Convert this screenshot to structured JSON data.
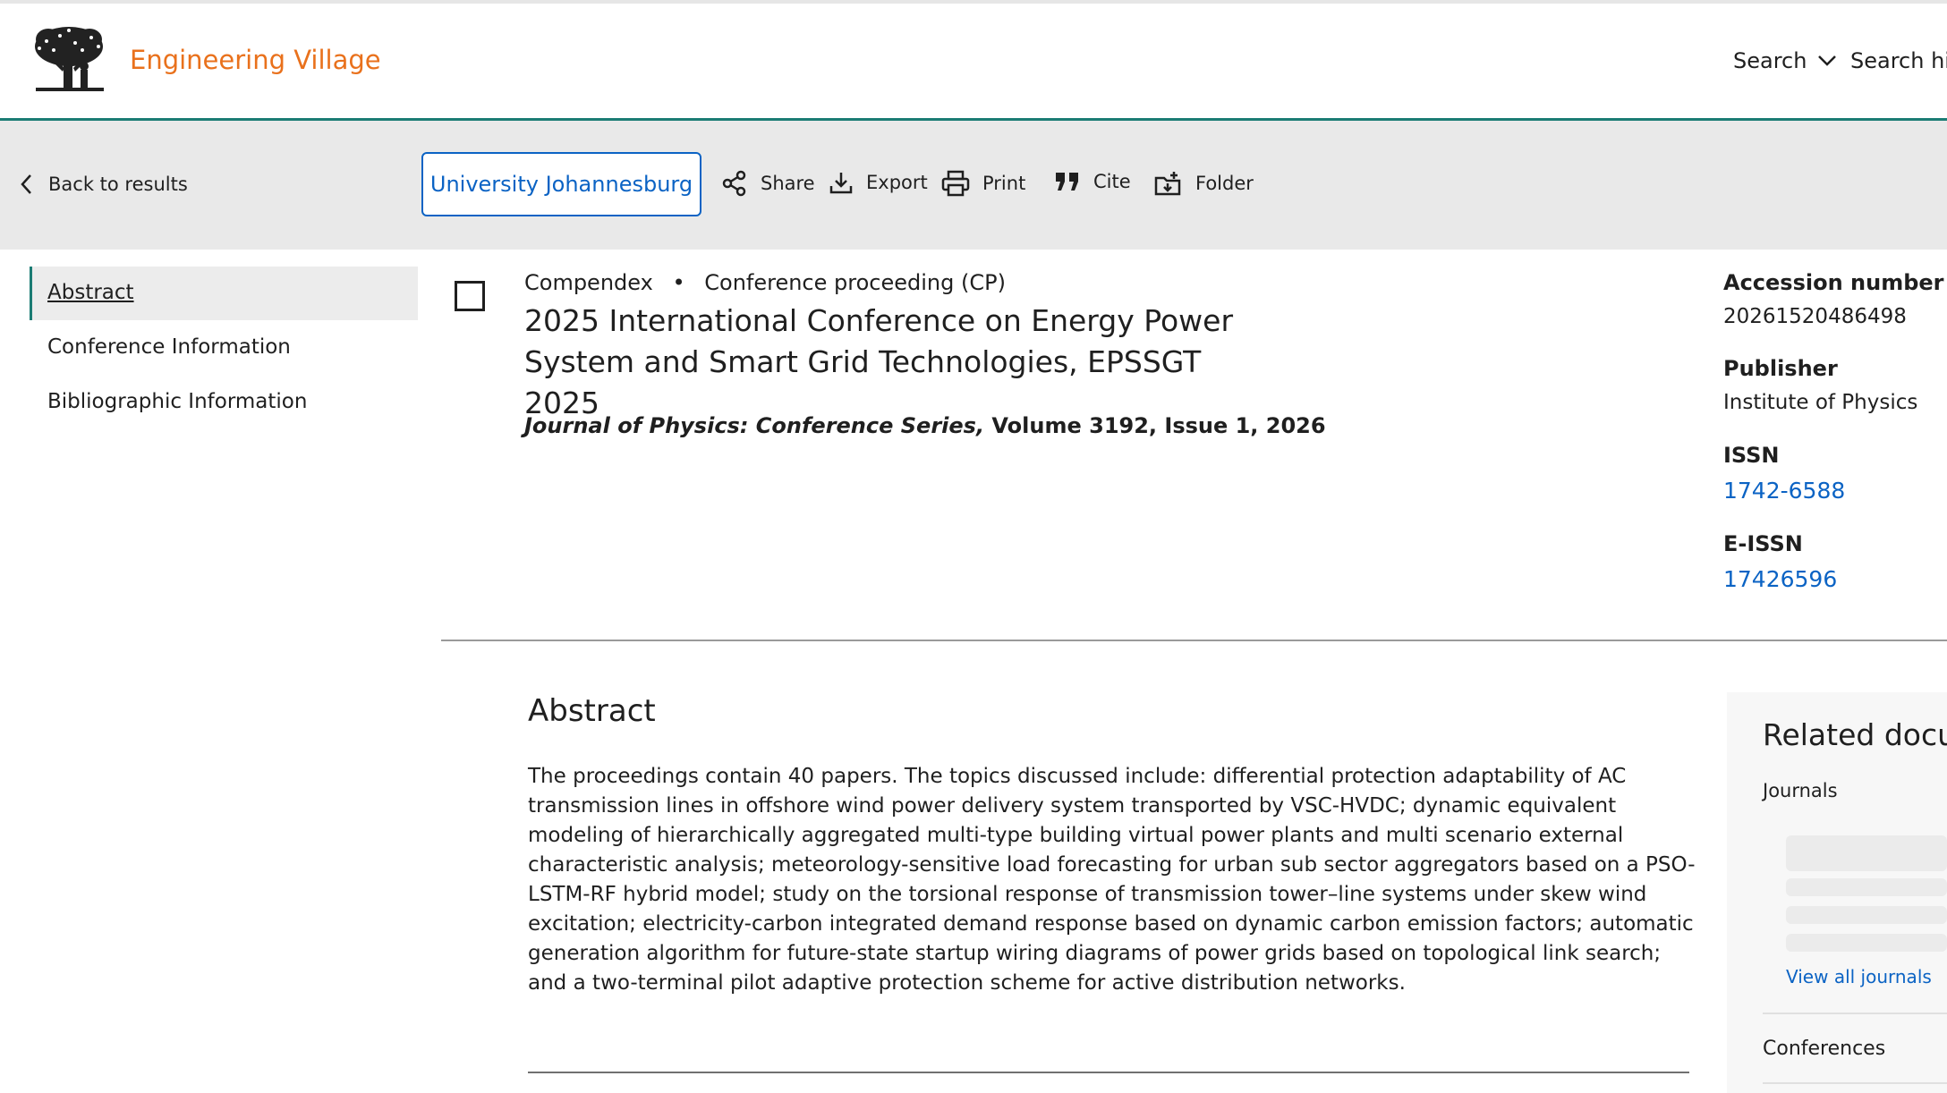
{
  "header": {
    "brand": "Engineering Village",
    "nav": {
      "search": "Search",
      "search_history": "Search his"
    }
  },
  "toolbar": {
    "back": "Back to results",
    "institution": "University Johannesburg",
    "share": "Share",
    "export": "Export",
    "print": "Print",
    "cite": "Cite",
    "folder": "Folder"
  },
  "sidebar": {
    "items": [
      {
        "label": "Abstract"
      },
      {
        "label": "Conference Information"
      },
      {
        "label": "Bibliographic Information"
      }
    ]
  },
  "record": {
    "database": "Compendex",
    "separator": "•",
    "doc_type": "Conference proceeding (CP)",
    "title_line1": "2025 International Conference on Energy Power",
    "title_line2": "System and Smart Grid Technologies, EPSSGT 2025",
    "journal_name": "Journal of Physics: Conference Series,",
    "journal_rest": " Volume 3192, Issue 1, 2026"
  },
  "details": {
    "accession_label": "Accession number",
    "accession_value": "20261520486498",
    "publisher_label": "Publisher",
    "publisher_value": "Institute of Physics",
    "issn_label": "ISSN",
    "issn_value": "1742-6588",
    "eissn_label": "E-ISSN",
    "eissn_value": "17426596"
  },
  "abstract": {
    "heading": "Abstract",
    "text": "The proceedings contain 40 papers. The topics discussed include: differential protection adaptability of AC transmission lines in offshore wind power delivery system transported by VSC-HVDC; dynamic equivalent modeling of hierarchically aggregated multi-type building virtual power plants and multi scenario external characteristic analysis; meteorology-sensitive load forecasting for urban sub sector aggregators based on a PSO-LSTM-RF hybrid model; study on the torsional response of transmission tower–line systems under skew wind excitation; electricity-carbon integrated demand response based on dynamic carbon emission factors; automatic generation algorithm for future-state startup wiring diagrams of power grids based on topological link search; and a two-terminal pilot adaptive protection scheme for active distribution networks."
  },
  "related": {
    "title": "Related docur",
    "journals_label": "Journals",
    "view_all_journals": "View all journals",
    "conferences_label": "Conferences"
  },
  "colors": {
    "brand_orange": "#e9711c",
    "link_blue": "#0b63c4",
    "accent_teal": "#1b7c74",
    "toolbar_gray": "#e9e9e9"
  }
}
